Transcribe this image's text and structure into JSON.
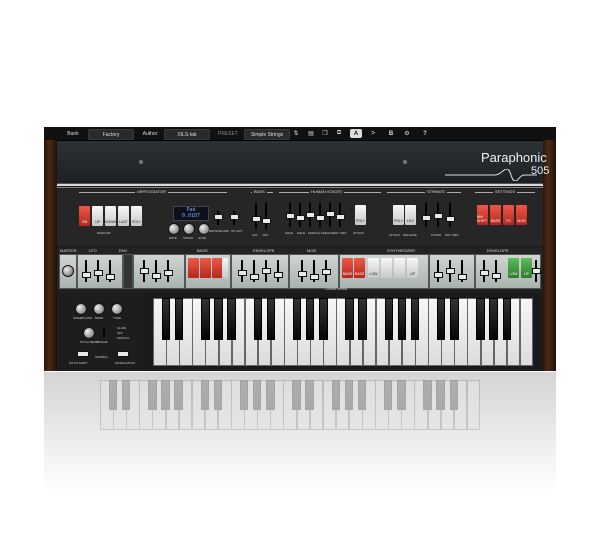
{
  "toolbar": {
    "bank_label": "Bank",
    "bank_value": "Factory",
    "author_label": "Author",
    "author_value": "XILS-lab",
    "preset_label": "PRESET",
    "preset_value": "Simple Strings",
    "a_button": "A",
    "arrow_button": ">",
    "b_button": "B",
    "help_button": "?"
  },
  "logo": {
    "line1": "Paraphonic",
    "line2": "505"
  },
  "sections": {
    "arpeggiator": "ARPEGGIATOR",
    "bass": "BASS",
    "human_voices": "HUMAN VOICES",
    "strings": "STRINGS",
    "settings": "SETTINGS"
  },
  "arp": {
    "on": "ON",
    "up": "UP",
    "down": "DOWN",
    "last": "LAST",
    "poly": "POLY",
    "random": "RANDOM",
    "lcd_line1": "Pad",
    "lcd_line2": "0.0107",
    "rate_label": "RATE",
    "swing_label": "SWING",
    "gate_label": "GATE",
    "arp_label": "BROWSE ARP",
    "ext_label": "INT EXT"
  },
  "bass_section": {
    "label1": "LEV",
    "label2": "MIX",
    "release": "RELEASE"
  },
  "human_voices": {
    "faders": [
      "MALE",
      "MALE",
      "FEMALE",
      "FEMALE",
      "DRY WET"
    ],
    "poly": "POLY",
    "attack": "ATTACK"
  },
  "strings_section": {
    "poly": "POLY",
    "leg": "LEG",
    "labels": [
      "ATTACK",
      "RELEASE",
      "FILTER",
      "DRY WET"
    ]
  },
  "settings": {
    "buttons": [
      "MIX SHIFT",
      "BASS",
      "FX",
      "MOD"
    ]
  },
  "lower_bar": {
    "titles": [
      "MASTER",
      "LFO",
      "ENV",
      "BASS",
      "ENVELOPE",
      "MOD",
      "SYNTHESIZER",
      "ENVELOPE"
    ],
    "lower_upper": "LOWER UPPER",
    "bass_buttons": [
      "",
      "",
      "",
      ""
    ],
    "synth_red": [
      "BASS",
      "BASS"
    ],
    "synth_white": [
      "LOW",
      "",
      "",
      "UP"
    ],
    "right_buttons": [
      "LOW",
      "UP"
    ]
  },
  "keyboard_panel": {
    "labels": [
      "SWEEP",
      "LONG",
      "BEND",
      "TUNE",
      "PITCH BEND",
      "RANGE",
      "GLIDE",
      "OFF",
      "MANUAL",
      "PITCH SHIFT",
      "NORMAL",
      "MODULATION"
    ]
  },
  "colors": {
    "accent_red": "#d8392b",
    "accent_green": "#3e9a3e",
    "lcd_blue": "#6fb4ff"
  }
}
